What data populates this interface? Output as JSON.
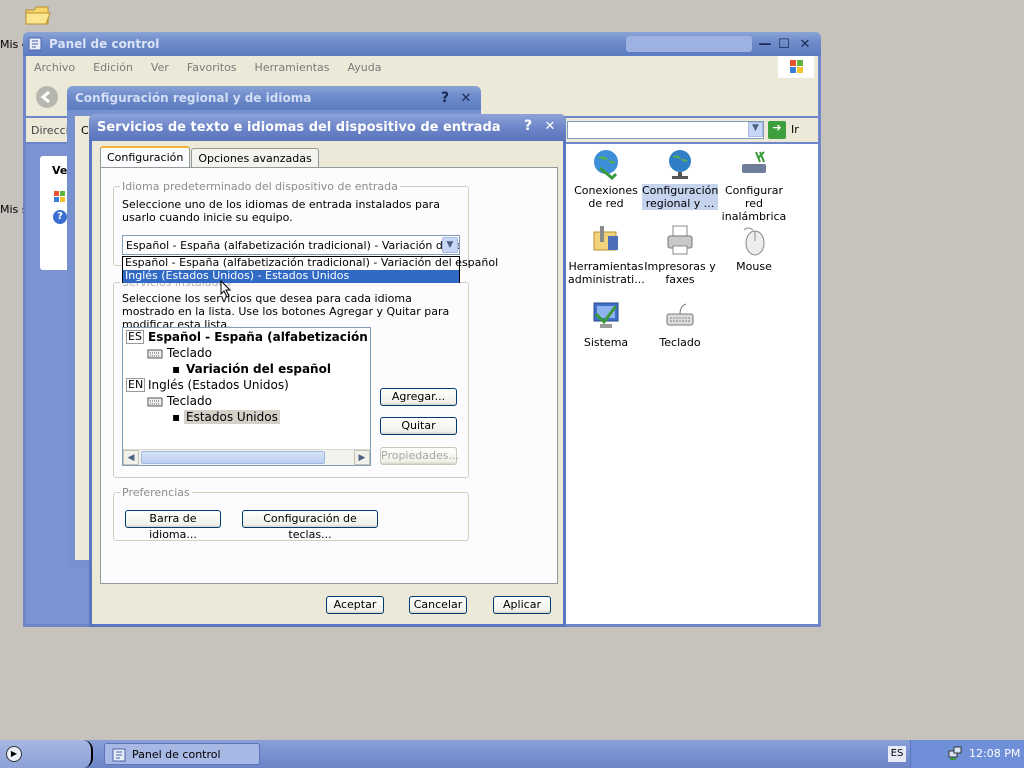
{
  "desktop": {
    "icon_label_1": "Mis d",
    "icon_label_2": "Mis s"
  },
  "control_panel": {
    "title": "Panel de control",
    "menu": [
      "Archivo",
      "Edición",
      "Ver",
      "Favoritos",
      "Herramientas",
      "Ayuda"
    ],
    "address_label": "Direcció",
    "go_label": "Ir",
    "left_pane_label": "Ve",
    "icons": [
      {
        "label": "Conexiones de red",
        "icon": "network-globe-icon"
      },
      {
        "label": "Configuración regional y ...",
        "icon": "regional-globe-icon",
        "selected": true
      },
      {
        "label": "Configurar red inalámbrica",
        "icon": "wireless-network-icon"
      },
      {
        "label": "Herramientas administrati...",
        "icon": "admin-tools-icon"
      },
      {
        "label": "Impresoras y faxes",
        "icon": "printer-icon"
      },
      {
        "label": "Mouse",
        "icon": "mouse-icon"
      },
      {
        "label": "Sistema",
        "icon": "system-computer-icon"
      },
      {
        "label": "Teclado",
        "icon": "keyboard-icon"
      }
    ]
  },
  "regional_dialog": {
    "title": "Configuración regional y de idioma",
    "help": "?",
    "close": "✕",
    "tab_stub": "C"
  },
  "text_services_dialog": {
    "title": "Servicios de texto e idiomas del dispositivo de entrada",
    "help": "?",
    "close": "✕",
    "tabs": [
      "Configuración",
      "Opciones avanzadas"
    ],
    "default_language_group": {
      "legend": "Idioma predeterminado del dispositivo de entrada",
      "description": "Seleccione uno de los idiomas de entrada instalados para usarlo cuando inicie su equipo.",
      "combo_value": "Español - España (alfabetización tradicional) - Variación del español",
      "options": [
        "Español - España (alfabetización tradicional) - Variación del español",
        "Inglés (Estados Unidos) - Estados Unidos"
      ],
      "highlighted_index": 1
    },
    "installed_services_group": {
      "legend": "Servicios instalados",
      "description": "Seleccione los servicios que desea para cada idioma mostrado en la lista. Use los botones Agregar y Quitar para modificar esta lista.",
      "tree": {
        "lang1_code": "ES",
        "lang1_name": "Español - España (alfabetización tradic",
        "lang1_type": "Teclado",
        "lang1_layout": "Variación del español",
        "lang2_code": "EN",
        "lang2_name": "Inglés (Estados Unidos)",
        "lang2_type": "Teclado",
        "lang2_layout": "Estados Unidos"
      },
      "buttons": {
        "add": "Agregar...",
        "remove": "Quitar",
        "properties": "Propiedades..."
      }
    },
    "preferences_group": {
      "legend": "Preferencias",
      "language_bar": "Barra de idioma...",
      "key_settings": "Configuración de teclas..."
    },
    "footer": {
      "ok": "Aceptar",
      "cancel": "Cancelar",
      "apply": "Aplicar"
    }
  },
  "taskbar": {
    "task": "Panel de control",
    "language": "ES",
    "clock": "12:08 PM"
  }
}
